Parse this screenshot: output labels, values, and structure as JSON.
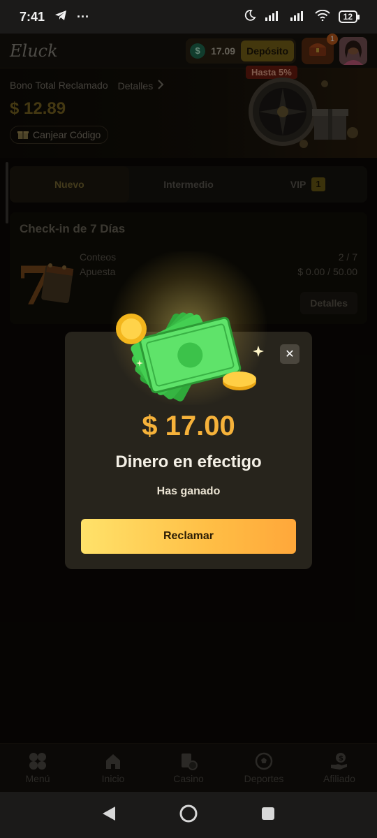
{
  "status_bar": {
    "time": "7:41",
    "battery": "12"
  },
  "header": {
    "logo": "Eluck",
    "balance_symbol": "$",
    "balance": "17.09",
    "deposit_label": "Depósito",
    "gift_badge": "1"
  },
  "bonus": {
    "label": "Bono Total Reclamado",
    "details_label": "Detalles",
    "amount": "$ 12.89",
    "redeem_label": "Canjear Código",
    "promo_badge": "Hasta 5%"
  },
  "tabs": [
    {
      "label": "Nuevo",
      "active": true
    },
    {
      "label": "Intermedio",
      "active": false
    },
    {
      "label": "VIP",
      "count": "1",
      "active": false
    }
  ],
  "checkin": {
    "title": "Check-in de 7 Días",
    "rows": [
      {
        "label": "Conteos",
        "value": "2 / 7"
      },
      {
        "label": "Apuesta",
        "value": "$ 0.00 / 50.00"
      }
    ],
    "details_label": "Detalles"
  },
  "modal": {
    "amount": "$ 17.00",
    "prize_type": "Dinero en efectigo",
    "subtitle": "Has ganado",
    "claim_label": "Reclamar"
  },
  "bottom_nav": [
    {
      "label": "Menú",
      "icon": "menu-clover-icon"
    },
    {
      "label": "Inicio",
      "icon": "home-icon"
    },
    {
      "label": "Casino",
      "icon": "casino-cards-icon"
    },
    {
      "label": "Deportes",
      "icon": "soccer-ball-icon"
    },
    {
      "label": "Afiliado",
      "icon": "affiliate-hand-dollar-icon"
    }
  ],
  "colors": {
    "accent_gold": "#f6b23a",
    "claim_gradient_start": "#ffe26a",
    "claim_gradient_end": "#ffa73a",
    "modal_bg": "#27241c"
  }
}
